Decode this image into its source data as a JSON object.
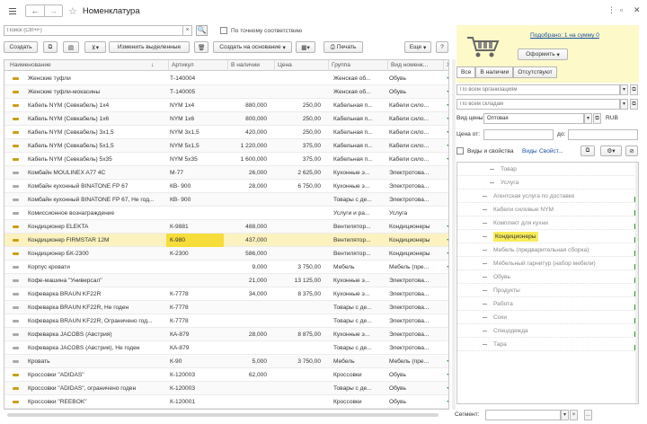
{
  "window": {
    "title": "Номенклатура",
    "back": "←",
    "forward": "→",
    "more": "⋮",
    "maximize": "▫",
    "close": "✕"
  },
  "search": {
    "placeholder": "Поиск (Ctrl+F)",
    "clear": "×",
    "button": "🔍",
    "exact_label": "По точному соответствию"
  },
  "toolbar": {
    "create": "Создать",
    "filter_arrow": "▾",
    "edit_selected": "Изменить выделенные",
    "create_based_on": "Создать на основание",
    "print": "Печать",
    "more": "Еще",
    "more_arrow": "▾",
    "help": "?"
  },
  "table": {
    "sort_icon": "↓",
    "columns": [
      "Наименование",
      "Артикул",
      "В наличии",
      "Цена",
      "Группа",
      "Вид номенк...",
      "Ха"
    ],
    "rows": [
      [
        "Женские туфли",
        "Т-140004",
        "",
        "",
        "Женская об...",
        "Обувь"
      ],
      [
        "Женские туфли-мокасины",
        "Т-140005",
        "",
        "",
        "Женская об...",
        "Обувь"
      ],
      [
        "Кабель NYM (Севкабель) 1х4",
        "NYM 1x4",
        "880,000",
        "250,00",
        "Кабельная п...",
        "Кабели сило..."
      ],
      [
        "Кабель NYM (Севкабель) 1х6",
        "NYM 1x6",
        "800,000",
        "250,00",
        "Кабельная п...",
        "Кабели сило..."
      ],
      [
        "Кабель NYM (Севкабель) 3х1,5",
        "NYM 3x1,5",
        "420,000",
        "250,00",
        "Кабельная п...",
        "Кабели сило..."
      ],
      [
        "Кабель NYM (Севкабель) 5х1,5",
        " NYM 5x1,5",
        "1 220,000",
        "375,00",
        "Кабельная п...",
        "Кабели сило..."
      ],
      [
        "Кабель NYM (Севкабель) 5х35",
        "NYM 5x35",
        "1 600,000",
        "375,00",
        "Кабельная п...",
        "Кабели сило..."
      ],
      [
        "Комбайн MOULINEX A77 4C",
        "М-77",
        "26,000",
        "2 625,00",
        "Кухонные э...",
        "Электротова..."
      ],
      [
        "Комбайн кухонный BINATONE FP 67",
        "КВ- 900",
        "28,000",
        "6 750,00",
        "Кухонные э...",
        "Электротова..."
      ],
      [
        "Комбайн кухонный BINATONE FP 67, Не год...",
        "КВ- 900",
        "",
        "",
        "Товары с де...",
        "Электротова..."
      ],
      [
        "Комиссионное вознаграждение",
        "",
        "",
        "",
        "Услуги и ра...",
        "Услуга"
      ],
      [
        "Кондиционер ELEKTA",
        "К-9881",
        "488,000",
        "",
        "Вентилятор...",
        "Кондиционеры"
      ],
      [
        "Кондиционер FIRMSTAR 12M",
        "К-980",
        "437,000",
        "",
        "Вентилятор...",
        "Кондиционеры"
      ],
      [
        "Кондиционер БК-2300",
        "К-2300",
        "586,000",
        "",
        "Вентилятор...",
        "Кондиционеры"
      ],
      [
        "Корпус кровати",
        "",
        "9,000",
        "3 750,00",
        "Мебель",
        "Мебель (пре..."
      ],
      [
        "Кофе-машина \"Универсал\"",
        "",
        "21,000",
        "13 125,00",
        "Кухонные э...",
        "Электротова..."
      ],
      [
        "Кофеварка BRAUN KF22R",
        "К-7778",
        "34,000",
        "8 375,00",
        "Кухонные э...",
        "Электротова..."
      ],
      [
        "Кофеварка BRAUN KF22R, Не годен",
        "К-7778",
        "",
        "",
        "Товары с де...",
        "Электротова..."
      ],
      [
        "Кофеварка BRAUN KF22R, Ограничено год...",
        "К-7778",
        "",
        "",
        "Товары с де...",
        "Электротова..."
      ],
      [
        "Кофеварка JACOBS (Австрия)",
        "КА-879",
        "28,000",
        "8 875,00",
        "Кухонные э...",
        "Электротова..."
      ],
      [
        "Кофеварка JACOBS (Австрия), Не годен",
        "КА-879",
        "",
        "",
        "Товары с де...",
        "Электротова..."
      ],
      [
        "Кровать",
        "К-90",
        "5,000",
        "3 750,00",
        "Мебель",
        "Мебель (пре..."
      ],
      [
        "Кроссовки \"ADIDAS\"",
        "К-120003",
        "62,000",
        "",
        "Кроссовки",
        "Обувь"
      ],
      [
        "Кроссовки \"ADIDAS\", ограничено годен",
        "К-120003",
        "",
        "",
        "Товары с де...",
        "Обувь"
      ],
      [
        "Кроссовки \"REEBOK\"",
        "К-120001",
        "",
        "",
        "Кроссовки",
        "Обувь"
      ]
    ]
  },
  "cart": {
    "link": "Подобрано: 1 на сумму 0",
    "checkout": "Оформить",
    "checkout_arrow": "▾"
  },
  "filters": {
    "tabs": [
      "Все",
      "В наличии",
      "Отсутствуют"
    ],
    "organization_placeholder": "По всем организациям",
    "warehouse_placeholder": "По всем складам",
    "price_type_label": "Вид цены:",
    "price_type_value": "Оптовая",
    "currency": "RUB",
    "price_from": "Цена от:",
    "price_to": "до:",
    "kinds_label": "Виды и свойства",
    "kinds_link": "Виды",
    "properties_link": "Свойст...",
    "ellipsis": "...",
    "open": "⧉",
    "arrow": "▾",
    "segment_label": "Сегмент:",
    "segment_clear": "×"
  },
  "tree": [
    {
      "label": "Товар",
      "level": 1
    },
    {
      "label": "Услуга",
      "level": 1
    },
    {
      "label": "Агентская услуга по доставке",
      "level": 2
    },
    {
      "label": "Кабели силовые NYM",
      "level": 2
    },
    {
      "label": "Комплект для кухни",
      "level": 2
    },
    {
      "label": "Кондиционеры",
      "level": 2,
      "active": true
    },
    {
      "label": "Мебель (предварительная сборка)",
      "level": 2
    },
    {
      "label": "Мебельный гарнитур (набор мебели)",
      "level": 2
    },
    {
      "label": "Обувь",
      "level": 2
    },
    {
      "label": "Продукты",
      "level": 2
    },
    {
      "label": "Работа",
      "level": 2
    },
    {
      "label": "Соки",
      "level": 2
    },
    {
      "label": "Спецодежда",
      "level": 2
    },
    {
      "label": "Тара",
      "level": 2
    }
  ]
}
